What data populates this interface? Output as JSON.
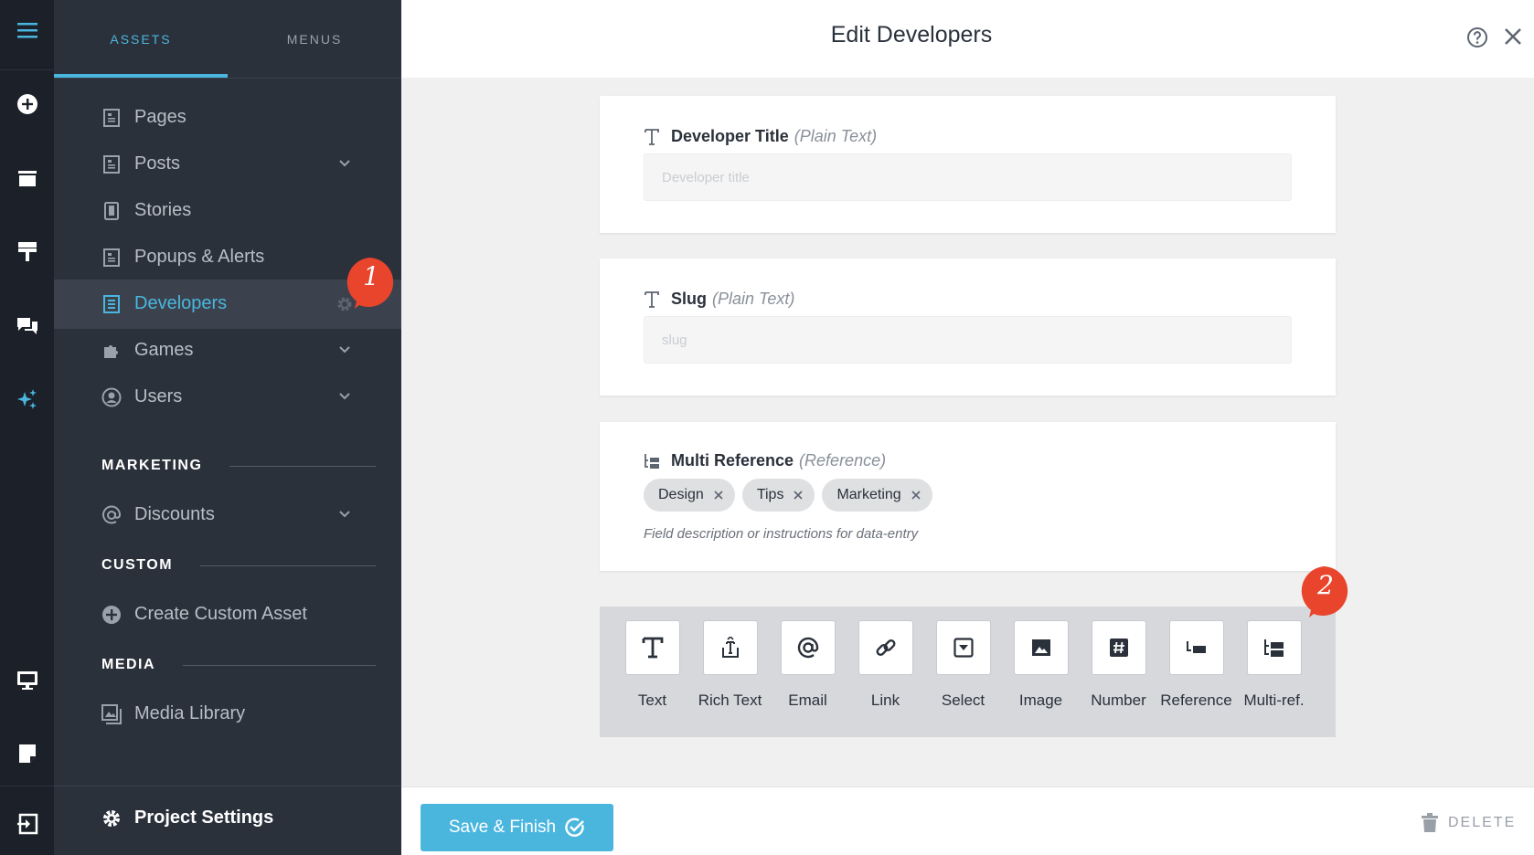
{
  "app": {
    "accent": "#4ab6de",
    "sidebar_bg": "#2b313b",
    "rail_bg": "#1b2029",
    "badge_color": "#e8452c"
  },
  "rail": {
    "icons": [
      "menu-icon",
      "add-circle-icon",
      "archive-icon",
      "theme-icon",
      "comments-icon",
      "sparkle-icon",
      "monitor-icon",
      "note-icon",
      "exit-icon"
    ]
  },
  "sidebar": {
    "tabs": [
      {
        "label": "ASSETS",
        "active": true
      },
      {
        "label": "MENUS",
        "active": false
      }
    ],
    "items": [
      {
        "label": "Pages",
        "icon": "page-icon",
        "chevron": false
      },
      {
        "label": "Posts",
        "icon": "page-icon",
        "chevron": true
      },
      {
        "label": "Stories",
        "icon": "story-icon",
        "chevron": false
      },
      {
        "label": "Popups & Alerts",
        "icon": "page-icon",
        "chevron": false
      },
      {
        "label": "Developers",
        "icon": "page-icon",
        "chevron": false,
        "active": true
      },
      {
        "label": "Games",
        "icon": "puzzle-icon",
        "chevron": true
      },
      {
        "label": "Users",
        "icon": "user-icon",
        "chevron": true
      },
      {
        "label": "Discounts",
        "icon": "at-icon",
        "chevron": true
      },
      {
        "label": "Create Custom Asset",
        "icon": "plus-circle-icon",
        "chevron": false
      },
      {
        "label": "Media Library",
        "icon": "media-icon",
        "chevron": false
      }
    ],
    "sections": {
      "marketing": "MARKETING",
      "custom": "CUSTOM",
      "media": "MEDIA"
    },
    "settings_label": "Project Settings"
  },
  "badges": {
    "one": "1",
    "two": "2"
  },
  "header": {
    "title": "Edit Developers"
  },
  "fields": [
    {
      "label": "Developer Title",
      "type": "(Plain Text)",
      "placeholder": "Developer title"
    },
    {
      "label": "Slug",
      "type": "(Plain Text)",
      "placeholder": "slug"
    },
    {
      "label": "Multi Reference",
      "type": "(Reference)",
      "chips": [
        "Design",
        "Tips",
        "Marketing"
      ],
      "description": "Field description or instructions for data-entry"
    }
  ],
  "palette": [
    {
      "label": "Text",
      "icon": "text-icon"
    },
    {
      "label": "Rich Text",
      "icon": "rich-text-icon"
    },
    {
      "label": "Email",
      "icon": "email-icon"
    },
    {
      "label": "Link",
      "icon": "link-icon"
    },
    {
      "label": "Select",
      "icon": "select-icon"
    },
    {
      "label": "Image",
      "icon": "image-icon"
    },
    {
      "label": "Number",
      "icon": "number-icon"
    },
    {
      "label": "Reference",
      "icon": "reference-icon"
    },
    {
      "label": "Multi-ref.",
      "icon": "multi-ref-icon"
    }
  ],
  "footer": {
    "save_label": "Save & Finish",
    "delete_label": "DELETE"
  }
}
